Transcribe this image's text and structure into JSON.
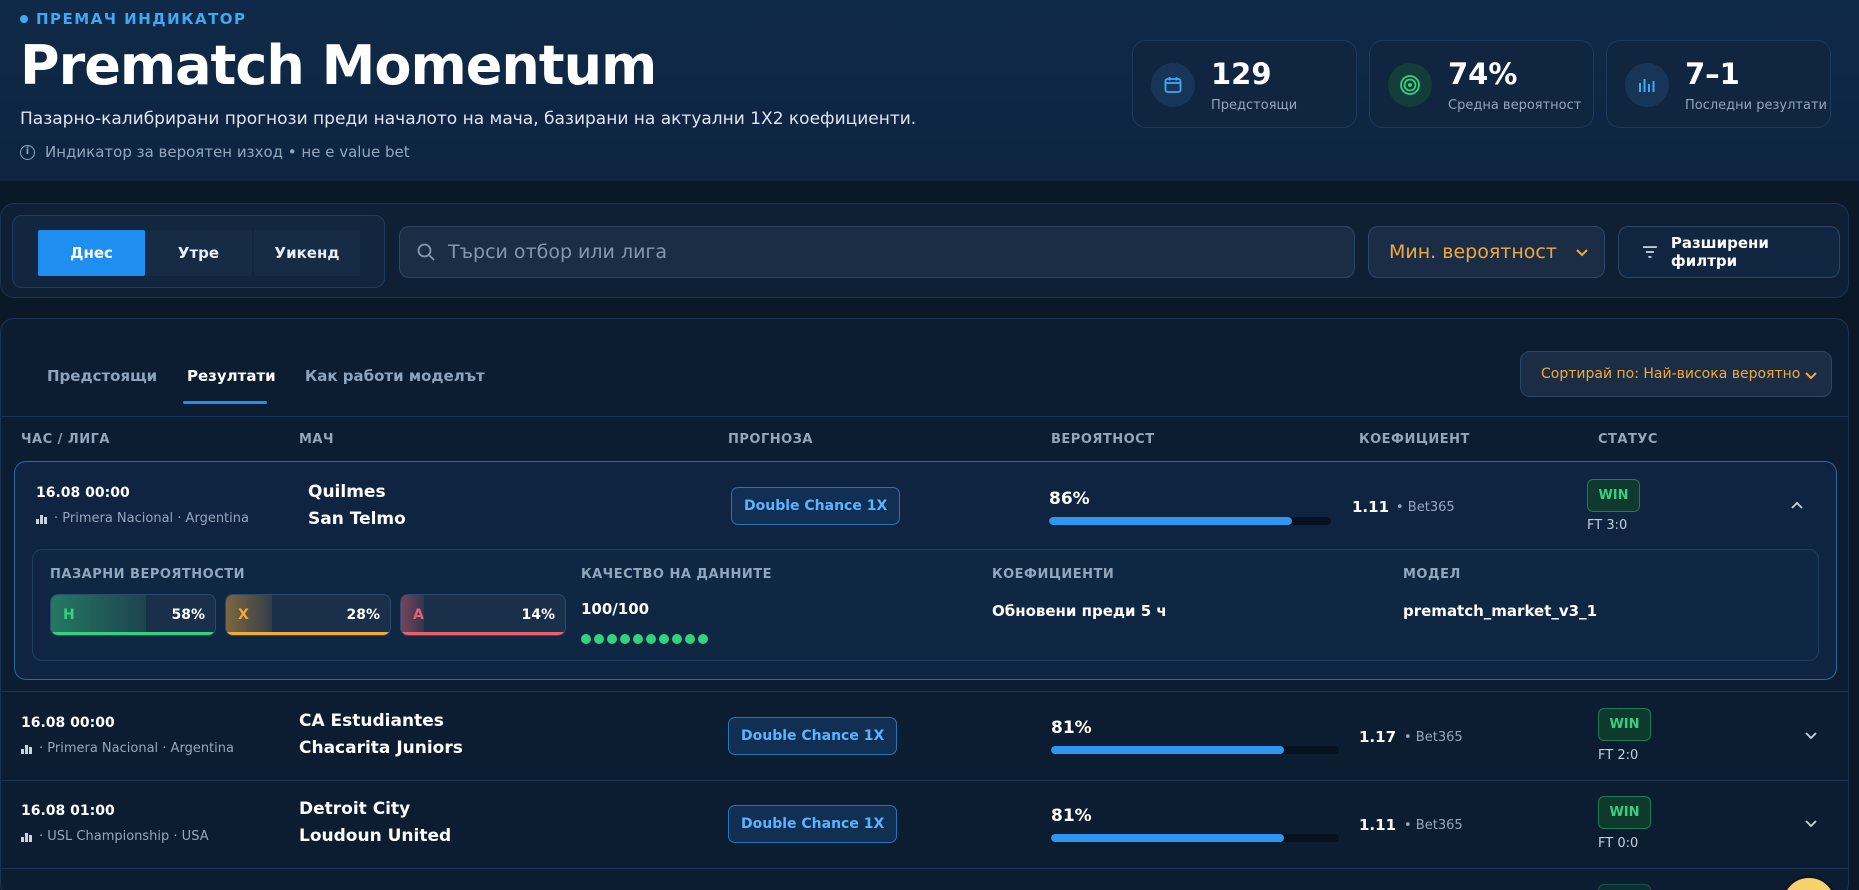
{
  "header": {
    "kicker": "ПРЕМАЧ ИНДИКАТОР",
    "title": "Prematch Momentum",
    "subtitle": "Пазарно-калибрирани прогнози преди началото на мача, базирани на актуални 1X2 коефициенти.",
    "note": "Индикатор за вероятен изход • не е value bet"
  },
  "stats": [
    {
      "value": "129",
      "label": "Предстоящи",
      "icon": "calendar-icon"
    },
    {
      "value": "74%",
      "label": "Средна вероятност",
      "icon": "target-icon"
    },
    {
      "value": "7–1",
      "label": "Последни резултати",
      "icon": "bar-chart-icon"
    }
  ],
  "filters": {
    "days": [
      "Днес",
      "Утре",
      "Уикенд"
    ],
    "active_day": "Днес",
    "search_placeholder": "Търси отбор или лига",
    "min_probability": "Мин. вероятност",
    "advanced": "Разширени филтри"
  },
  "tabs": [
    "Предстоящи",
    "Резултати",
    "Как работи моделът"
  ],
  "active_tab": "Резултати",
  "sort_label": "Сортирай по: Най-висока вероятно",
  "columns": [
    "ЧАС / ЛИГА",
    "МАЧ",
    "ПРОГНОЗА",
    "ВЕРОЯТНОСТ",
    "КОЕФИЦИЕНТ",
    "СТАТУС"
  ],
  "matches": [
    {
      "time": "16.08 00:00",
      "league": "· Primera Nacional · Argentina",
      "home": "Quilmes",
      "away": "San Telmo",
      "prediction": "Double Chance 1X",
      "probability": "86%",
      "probability_value": 0.86,
      "odds": "1.11",
      "bookmaker": "• Bet365",
      "status": "WIN",
      "score": "FT 3:0"
    },
    {
      "time": "16.08 00:00",
      "league": "· Primera Nacional · Argentina",
      "home": "CA Estudiantes",
      "away": "Chacarita Juniors",
      "prediction": "Double Chance 1X",
      "probability": "81%",
      "probability_value": 0.81,
      "odds": "1.17",
      "bookmaker": "• Bet365",
      "status": "WIN",
      "score": "FT 2:0"
    },
    {
      "time": "16.08 01:00",
      "league": "· USL Championship · USA",
      "home": "Detroit City",
      "away": "Loudoun United",
      "prediction": "Double Chance 1X",
      "probability": "81%",
      "probability_value": 0.81,
      "odds": "1.11",
      "bookmaker": "• Bet365",
      "status": "WIN",
      "score": "FT 0:0"
    }
  ],
  "details": {
    "market_label": "ПАЗАРНИ ВЕРОЯТНОСТИ",
    "market": [
      {
        "label": "H",
        "pct": "58%",
        "value": 0.58,
        "color": "#34d27f"
      },
      {
        "label": "X",
        "pct": "28%",
        "value": 0.28,
        "color": "#f2a93b"
      },
      {
        "label": "A",
        "pct": "14%",
        "value": 0.14,
        "color": "#e8616d"
      }
    ],
    "quality_label": "КАЧЕСТВО НА ДАННИТЕ",
    "quality_value": "100/100",
    "quality_dots": 10,
    "odds_label": "КОЕФИЦИЕНТИ",
    "odds_value": "Обновени преди 5 ч",
    "model_label": "МОДЕЛ",
    "model_value": "prematch_market_v3_1"
  },
  "colors": {
    "accent": "#1e8ff0",
    "win": "#34d27f",
    "warning": "#f2a93b"
  }
}
